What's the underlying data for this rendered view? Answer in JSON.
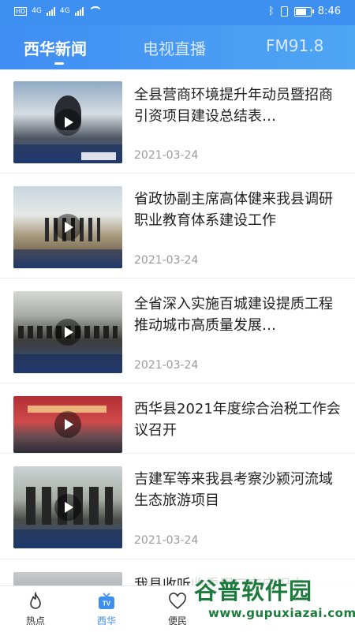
{
  "status_bar": {
    "left_labels": [
      "HD",
      "4G",
      "4G"
    ],
    "time": "8:46",
    "icons": [
      "signal-icon",
      "wifi-icon",
      "bluetooth-icon",
      "vibrate-icon",
      "battery-icon"
    ]
  },
  "header": {
    "tabs": [
      {
        "label": "西华新闻",
        "active": true
      },
      {
        "label": "电视直播",
        "active": false
      },
      {
        "label": "FM91.8",
        "active": false
      }
    ]
  },
  "news": [
    {
      "title": "全县营商环境提升年动员暨招商引资项目建设总结表…",
      "date": "2021-03-24"
    },
    {
      "title": "省政协副主席高体健来我县调研职业教育体系建设工作",
      "date": "2021-03-24"
    },
    {
      "title": "全省深入实施百城建设提质工程推动城市高质量发展…",
      "date": "2021-03-24"
    },
    {
      "title": "西华县2021年度综合治税工作会议召开",
      "date": ""
    },
    {
      "title": "吉建军等来我县考察沙颍河流域生态旅游项目",
      "date": "2021-03-24"
    },
    {
      "title": "我县收听收看周口市庆祝中",
      "date": ""
    }
  ],
  "bottom_nav": [
    {
      "label": "热点",
      "icon": "flame-icon",
      "active": false
    },
    {
      "label": "西华",
      "icon": "tv-icon",
      "active": true
    },
    {
      "label": "便民",
      "icon": "heart-icon",
      "active": false
    }
  ],
  "watermark": {
    "title": "谷普软件园",
    "url": "www.gupuxiazai.com"
  },
  "colors": {
    "accent": "#3d8ff0",
    "watermark": "#1d7a3d"
  }
}
